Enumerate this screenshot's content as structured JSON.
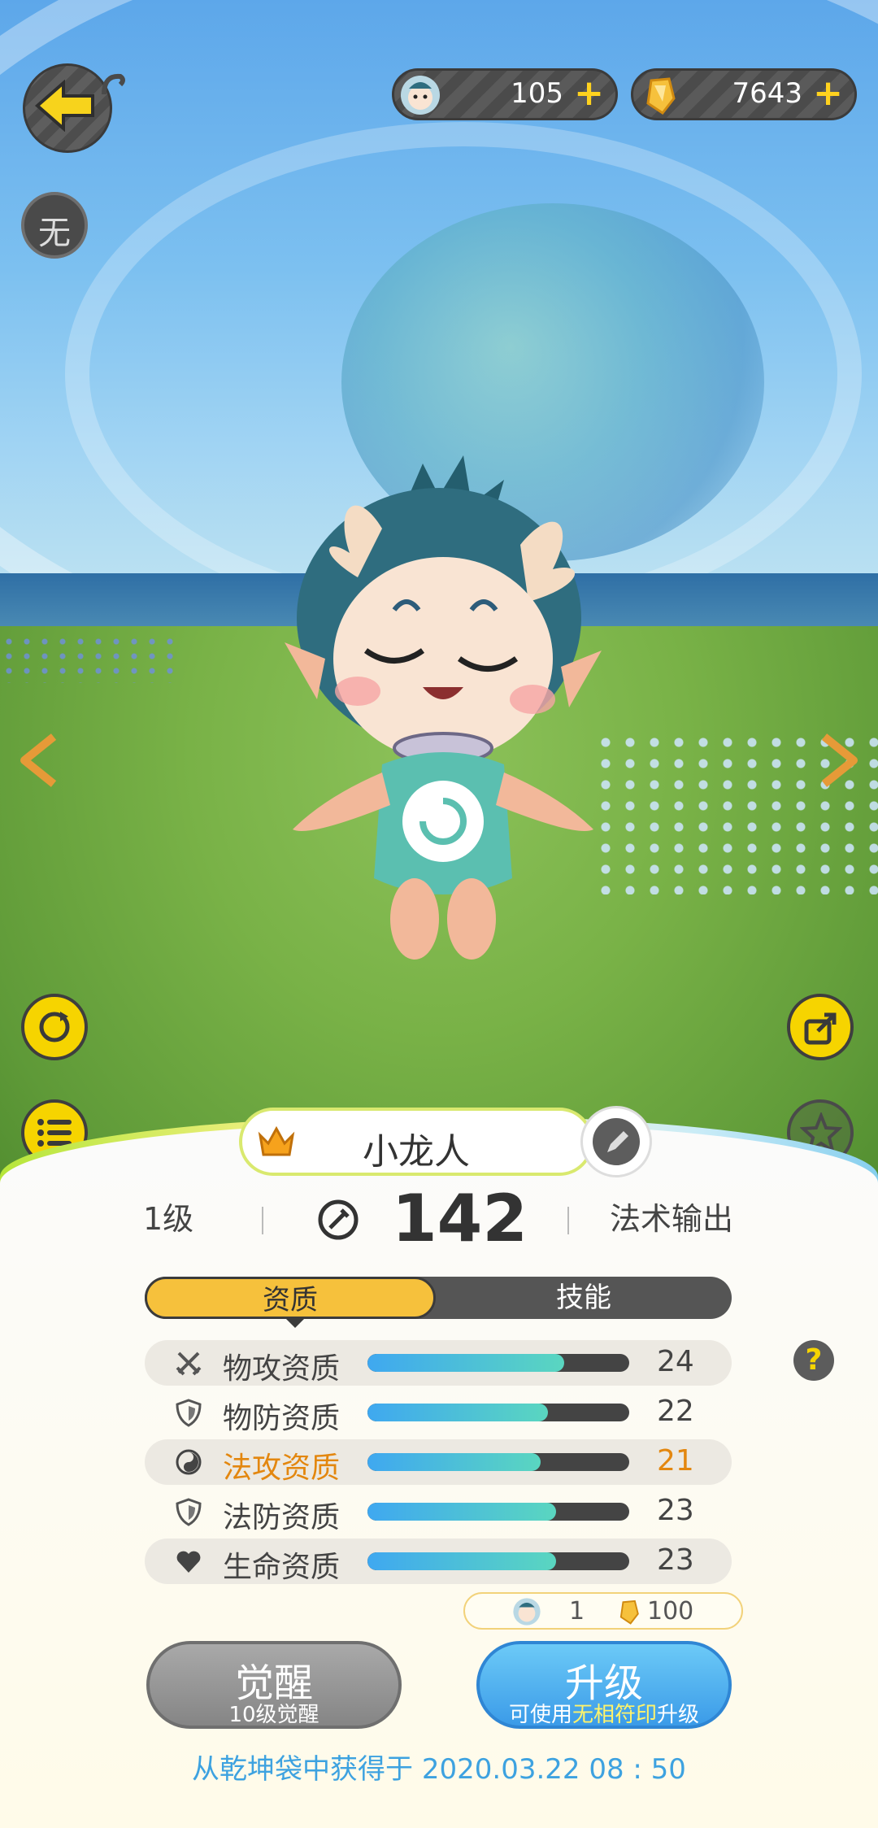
{
  "resources": {
    "pet_tokens": {
      "value": "105",
      "icon": "pet-face-icon"
    },
    "crystals": {
      "value": "7643",
      "icon": "gold-crystal-icon"
    },
    "plus_label": "+"
  },
  "left_controls": {
    "none_badge": "无"
  },
  "pet": {
    "name": "小龙人",
    "level": "1级",
    "power": "142",
    "role": "法术输出"
  },
  "tabs": {
    "aptitude": "资质",
    "skills": "技能"
  },
  "aptitudes": [
    {
      "label": "物攻资质",
      "value": "24",
      "fill": 0.75,
      "icon": "crossed-swords-icon"
    },
    {
      "label": "物防资质",
      "value": "22",
      "fill": 0.69,
      "icon": "shield-icon"
    },
    {
      "label": "法攻资质",
      "value": "21",
      "fill": 0.66,
      "icon": "magic-swirl-icon",
      "highlight": true
    },
    {
      "label": "法防资质",
      "value": "23",
      "fill": 0.72,
      "icon": "shield-icon"
    },
    {
      "label": "生命资质",
      "value": "23",
      "fill": 0.72,
      "icon": "heart-icon"
    }
  ],
  "help_label": "?",
  "cost": {
    "tokens": "1",
    "crystals": "100"
  },
  "awaken": {
    "title": "觉醒",
    "subtitle": "10级觉醒"
  },
  "upgrade": {
    "title": "升级",
    "sub_prefix": "可使用",
    "sub_highlight": "无相符印",
    "sub_suffix": "升级"
  },
  "obtained": "从乾坤袋中获得于 2020.03.22   08 : 50",
  "colors": {
    "accent_yellow": "#f6c13c",
    "highlight_orange": "#e3870f",
    "upgrade_blue": "#3b9be8",
    "info_blue": "#3da2e0"
  }
}
